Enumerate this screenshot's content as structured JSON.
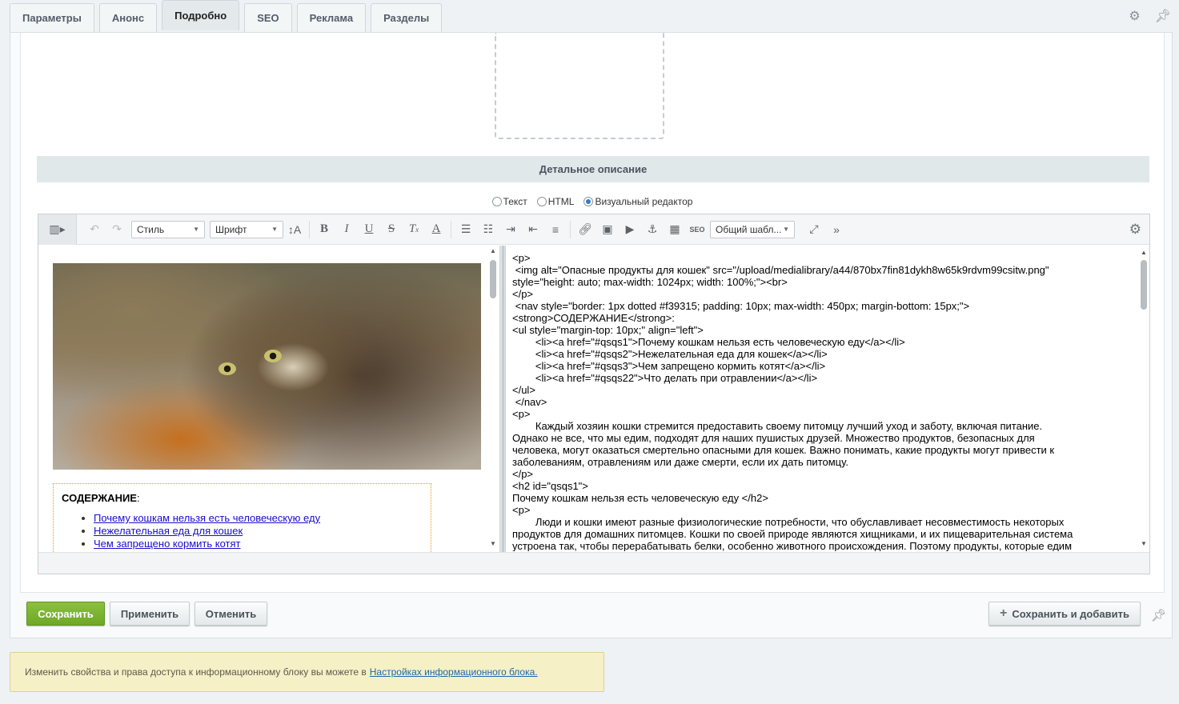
{
  "tabs": [
    {
      "label": "Параметры"
    },
    {
      "label": "Анонс"
    },
    {
      "label": "Подробно"
    },
    {
      "label": "SEO"
    },
    {
      "label": "Реклама"
    },
    {
      "label": "Разделы"
    }
  ],
  "active_tab": "Подробно",
  "section_title": "Детальное описание",
  "editor_modes": [
    {
      "label": "Текст",
      "selected": false
    },
    {
      "label": "HTML",
      "selected": false
    },
    {
      "label": "Визуальный редактор",
      "selected": true
    }
  ],
  "toolbar": {
    "style_select": "Стиль",
    "font_select": "Шрифт",
    "template_select": "Общий шабл...",
    "seo_label": "SEO"
  },
  "visual": {
    "toc_title": "СОДЕРЖАНИЕ",
    "toc_title_suffix": ":",
    "toc_items": [
      "Почему кошкам нельзя есть человеческую еду",
      "Нежелательная еда для кошек",
      "Чем запрещено кормить котят"
    ]
  },
  "code_lines": [
    "<p>",
    " <img alt=\"Опасные продукты для кошек\" src=\"/upload/medialibrary/a44/870bx7fin81dykh8w65k9rdvm99csitw.png\"",
    "style=\"height: auto; max-width: 1024px; width: 100%;\"><br>",
    "</p>",
    " <nav style=\"border: 1px dotted #f39315; padding: 10px; max-width: 450px; margin-bottom: 15px;\">",
    "<strong>СОДЕРЖАНИЕ</strong>:",
    "<ul style=\"margin-top: 10px;\" align=\"left\">",
    "        <li><a href=\"#qsqs1\">Почему кошкам нельзя есть человеческую еду</a></li>",
    "        <li><a href=\"#qsqs2\">Нежелательная еда для кошек</a></li>",
    "        <li><a href=\"#qsqs3\">Чем запрещено кормить котят</a></li>",
    "        <li><a href=\"#qsqs22\">Что делать при отравлении</a></li>",
    "</ul>",
    " </nav>",
    "<p>",
    "        Каждый хозяин кошки стремится предоставить своему питомцу лучший уход и заботу, включая питание.",
    "Однако не все, что мы едим, подходят для наших пушистых друзей. Множество продуктов, безопасных для",
    "человека, могут оказаться смертельно опасными для кошек. Важно понимать, какие продукты могут привести к",
    "заболеваниям, отравлениям или даже смерти, если их дать питомцу.",
    "</p>",
    "<h2 id=\"qsqs1\">",
    "Почему кошкам нельзя есть человеческую еду </h2>",
    "<p>",
    "        Люди и кошки имеют разные физиологические потребности, что обуславливает несовместимость некоторых",
    "продуктов для домашних питомцев. Кошки по своей природе являются хищниками, и их пищеварительная система",
    "устроена так, чтобы перерабатывать белки, особенно животного происхождения. Поэтому продукты, которые едим"
  ],
  "buttons": {
    "save": "Сохранить",
    "apply": "Применить",
    "cancel": "Отменить",
    "save_add": "Сохранить и добавить"
  },
  "note": {
    "text": "Изменить свойства и права доступа к информационному блоку вы можете в",
    "link": "Настройках информационного блока."
  },
  "colors": {
    "save_button": "#7bb52f",
    "toc_border": "#f39315",
    "note_bg": "#f5f0c6",
    "link": "#1a0dcc"
  }
}
